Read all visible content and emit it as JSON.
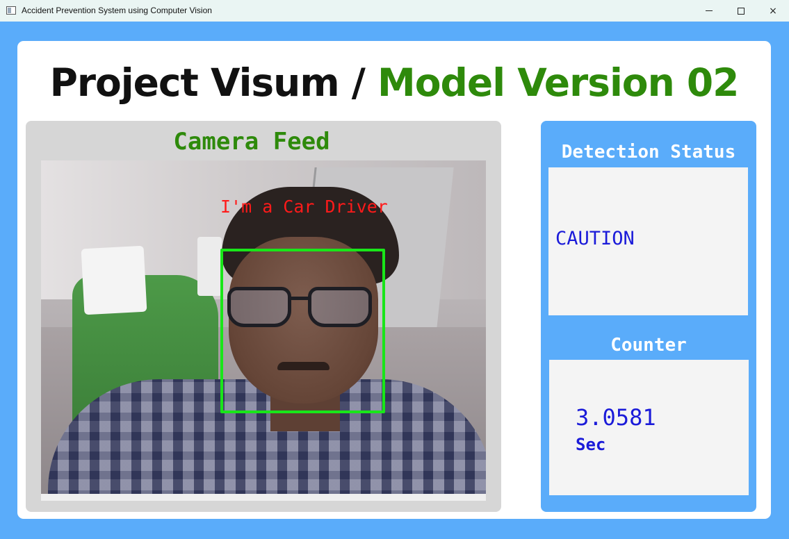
{
  "window": {
    "title": "Accident Prevention System using Computer Vision",
    "controls": {
      "minimize": "minimize-icon",
      "maximize": "maximize-icon",
      "close": "×"
    }
  },
  "header": {
    "project": "Project Visum / ",
    "model": "Model Version 02"
  },
  "camera": {
    "title": "Camera Feed",
    "overlay_label": "I'm a Car Driver"
  },
  "detection": {
    "title": "Detection Status",
    "status": "CAUTION"
  },
  "counter": {
    "title": "Counter",
    "value": "3.0581",
    "unit": "Sec"
  },
  "colors": {
    "window_bg": "#5aacfa",
    "accent_green": "#2e8a0b",
    "status_blue": "#1b1bd9",
    "face_box": "#19e619",
    "overlay_red": "#ff1a1a"
  }
}
